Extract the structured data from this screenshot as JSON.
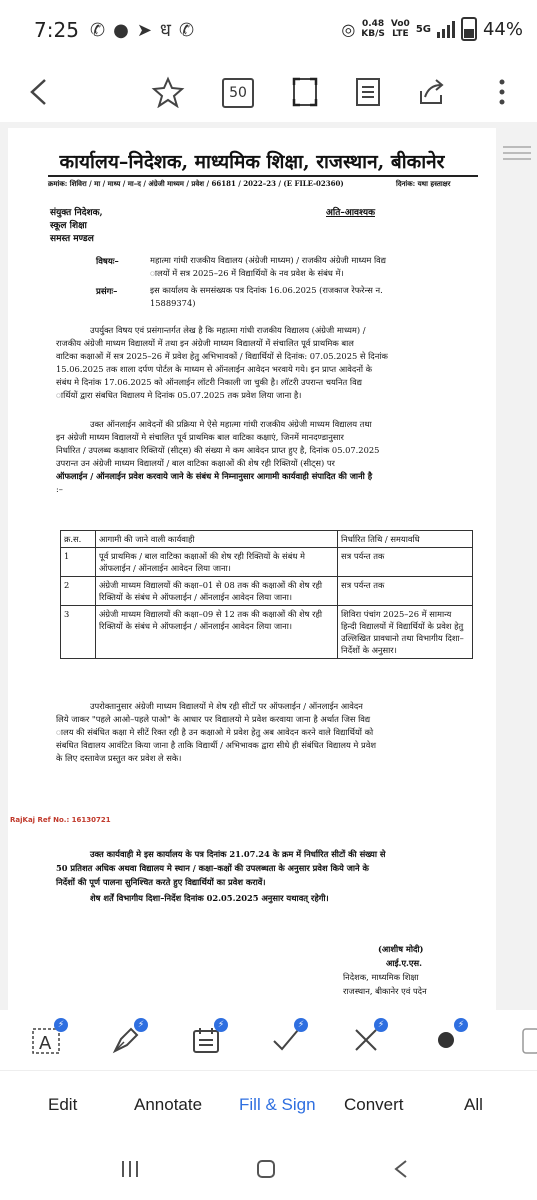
{
  "status": {
    "time": "7:25",
    "net_speed": "0.48\nKB/S",
    "volte": "Vo0\nLTE",
    "network": "5G",
    "battery": "44%"
  },
  "toolbar": {
    "zoom": "50"
  },
  "document": {
    "title": "कार्यालय–निदेशक, माध्यमिक शिक्षा, राजस्थान, बीकानेर",
    "ref": "क्रमांक: शिविरा / मा / माध्य / मा–द / अंग्रेजी माध्यम / प्रवेश / 66181 / 2022–23 / (E FILE-02360)",
    "date": "दिनांक: यथा हस्ताक्षर",
    "addr1": "संयुक्त निदेशक,",
    "addr2": "स्कूल शिक्षा",
    "addr3": "समस्त मण्डल",
    "urgent": "अति–आवश्यक",
    "subject_label": "विषयः–",
    "subject_l1": "महात्मा गांधी राजकीय विद्यालय (अंग्रेजी माध्यम) / राजकीय अंग्रेजी माध्यम विद्य",
    "subject_l2": "ालयों में सत्र 2025–26 में विद्यार्थियों के नव प्रवेश के संबंध में।",
    "context_label": "प्रसंगः–",
    "context_l1": "इस कार्यालय के समसंख्यक पत्र दिनांक 16.06.2025 (राजकाज रेफरेन्स न.",
    "context_l2": "15889374)",
    "para1": [
      "उपर्युक्त विषय एवं प्रसंगान्तर्गत लेख है कि महात्मा गांधी राजकीय विद्यालय (अंग्रेजी माध्यम) /",
      "राजकीय अंग्रेजी माध्यम विद्यालयों में तथा इन अंग्रेजी माध्यम विद्यालयों में संचालित पूर्व प्राथमिक बाल",
      "वाटिका कक्षाओं में सत्र 2025–26 में प्रवेश हेतु अभिभावकों / विद्यार्थियों से दिनांक: 07.05.2025 से दिनांक",
      "15.06.2025 तक शाला दर्पण पोर्टल के माध्यम से ऑनलाईन आवेदन भरवाये गये। इन प्राप्त आवेदनों के",
      "संबंध मे दिनांक 17.06.2025 को ऑनलाईन लॉटरी निकाली जा चुकी है। लॉटरी उपरान्त चयनित विद्य",
      "ार्थियों द्वारा संबधित विद्यालय मे दिनांक 05.07.2025 तक प्रवेश लिया जाना है।"
    ],
    "para2": [
      "उक्त ऑनलाईन आवेदनों की प्रक्रिया मे ऐसे महात्मा गांधी राजकीय अंग्रेजी माध्यम विद्यालय तथा",
      "इन अंग्रेजी माध्यम विद्यालयों मे संचालित पूर्व प्राथमिक बाल वाटिका कक्षाएं, जिनमें मानदण्डानुसार",
      "निर्धारित / उपलब्ध कक्षावार रिक्तियों (सीट्स) की संख्या मे कम आवेदन प्राप्त हुए है, दिनांक 05.07.2025",
      "उपरान्त उन अंग्रेजी माध्यम विद्यालयों / बाल वाटिका कक्षाओं की शेष रही रिक्तियों (सीट्स) पर",
      "ऑफलाईन / ऑनलाईन प्रवेश करवाये जाने के संबंध मे निम्नानुसार आगामी कार्यवाही संपादित की जानी है",
      ":–"
    ],
    "table": {
      "headers": [
        "क्र.स.",
        "आगामी की जाने वाली कार्यवाही",
        "निर्धारित तिथि / समयावधि"
      ],
      "rows": [
        {
          "sn": "1",
          "action": "पूर्व प्राथमिक / बाल वाटिका कक्षाओं की शेष रही रिक्तियों के संबंध मे ऑफलाईन / ऑनलाईन आवेदन लिया जाना।",
          "when": "सत्र पर्यन्त तक"
        },
        {
          "sn": "2",
          "action": "अंग्रेजी माध्यम विद्यालयों की कक्षा–01 से 08 तक की कक्षाओं की शेष रही रिक्तियों के संबंध मे ऑफलाईन / ऑनलाईन आवेदन लिया जाना।",
          "when": "सत्र पर्यन्त तक"
        },
        {
          "sn": "3",
          "action": "अंग्रेजी माध्यम विद्यालयों की कक्षा–09 से 12 तक की कक्षाओं की शेष रही रिक्तियों के संबंध मे ऑफलाईन / ऑनलाईन आवेदन लिया जाना।",
          "when": "शिविरा पंचांग 2025–26 में सामान्य हिन्दी विद्यालयों में विद्यार्थियों के प्रवेश हेतु उल्लिखित प्रावधानो तथा विभागीय दिशा–निर्देशों के अनुसार।"
        }
      ]
    },
    "para3": [
      "उपरोक्तानुसार अंग्रेजी माध्यम विद्यालयों मे शेष रही सीटों पर ऑफलाईन / ऑनलाईन आवेदन",
      "लिये जाकर \"पहले आओ–पहले पाओ\" के आधार पर विद्यालयो मे प्रवेश करवाया जाना है अर्थात जिस विद्य",
      "ालय की संबंधित कक्षा मे सीटें रिक्त रही है उन कक्षाओ मे प्रवेश हेतु अब आवेदन करने वाले विद्यार्थियों को",
      "संबधित विद्यालय आवंटित किया जाना है ताकि विद्यार्थी / अभिभावक द्वारा सीधे ही संबंधित विद्यालय मे प्रवेश",
      "के लिए दस्तावेज प्रस्तुत कर प्रवेश ले सके।"
    ],
    "rajkaj": "RajKaj Ref No.: 16130721",
    "para4": [
      "उक्त कार्यवाही मे इस कार्यालय के पत्र दिनांक 21.07.24 के क्रम में निर्धारित सीटों की संख्या से",
      "50 प्रतिशत अधिक अथवा विद्यालय मे स्थान / कक्षा–कक्षों की उपलब्धता के अनुसार प्रवेश किये जाने के",
      "निर्देशों की पूर्ण पालना सुनिश्चित करते हुए विद्यार्थियों का प्रवेश करावें।",
      "शेष शर्तें विभागीय दिशा–निर्देश दिनांक 02.05.2025 अनुसार यथावत् रहेगी।"
    ],
    "sign": {
      "name": "(आशीष मोदी)",
      "service": "आई.ए.एस.",
      "designation": "निदेशक, माध्यमिक शिक्षा",
      "location": "राजस्थान, बीकानेर एवं पदेन"
    }
  },
  "bottom_tabs": [
    "Edit",
    "Annotate",
    "Fill & Sign",
    "Convert",
    "All"
  ],
  "colors": {
    "accent": "#2f6fe0",
    "rajkaj": "#c0392b"
  }
}
